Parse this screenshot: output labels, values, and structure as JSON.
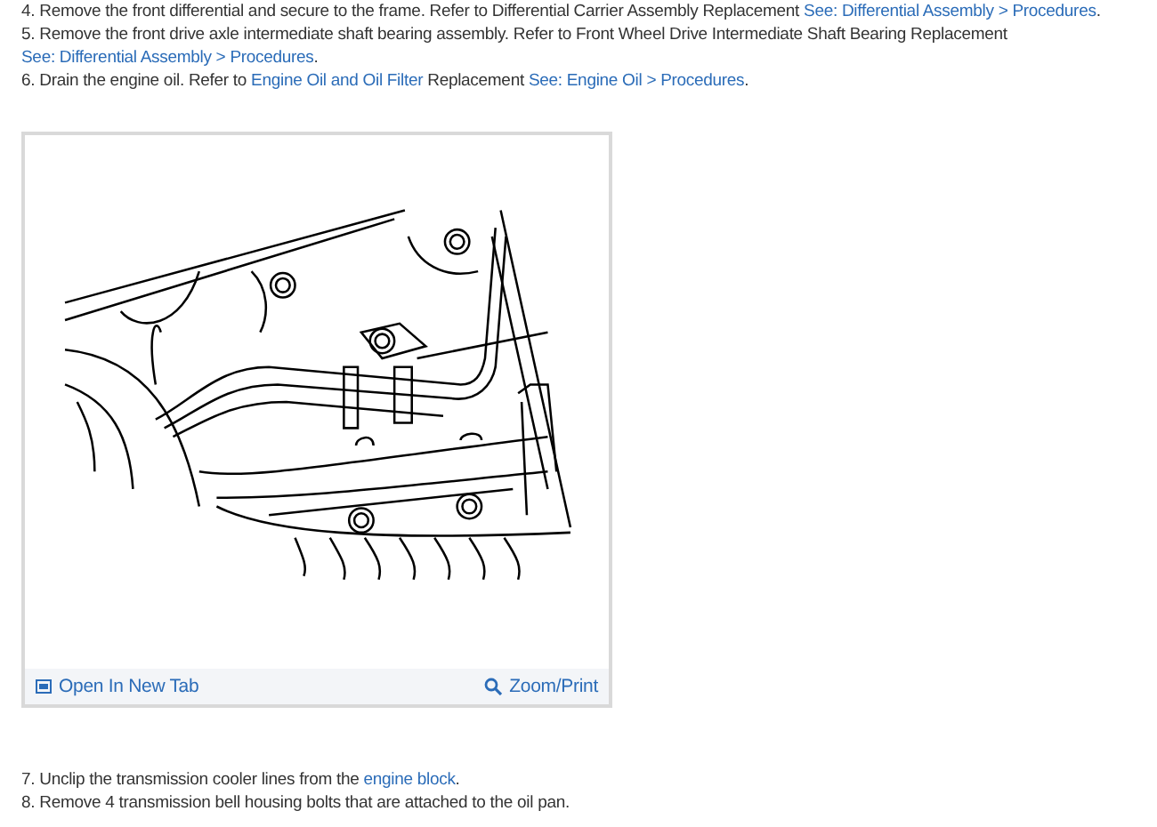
{
  "steps_before": [
    {
      "number": "4.",
      "parts": [
        {
          "kind": "text",
          "text": "Remove the front differential and secure to the frame. Refer to Differential Carrier Assembly Replacement "
        },
        {
          "kind": "link",
          "text": "See: Differential Assembly > Procedures"
        },
        {
          "kind": "text",
          "text": "."
        }
      ]
    },
    {
      "number": "5.",
      "parts": [
        {
          "kind": "text",
          "text": "Remove the front drive axle intermediate shaft bearing assembly. Refer to Front Wheel Drive Intermediate Shaft Bearing Replacement "
        },
        {
          "kind": "link",
          "text": "See: Differential Assembly > Procedures"
        },
        {
          "kind": "text",
          "text": "."
        }
      ]
    },
    {
      "number": "6.",
      "parts": [
        {
          "kind": "text",
          "text": "Drain the engine oil. Refer to "
        },
        {
          "kind": "link",
          "text": "Engine Oil and Oil Filter"
        },
        {
          "kind": "text",
          "text": " Replacement "
        },
        {
          "kind": "link",
          "text": "See: Engine Oil > Procedures"
        },
        {
          "kind": "text",
          "text": "."
        }
      ]
    }
  ],
  "figure": {
    "open_link": "Open In New Tab",
    "zoom_link": "Zoom/Print"
  },
  "steps_after": [
    {
      "number": "7.",
      "parts": [
        {
          "kind": "text",
          "text": "Unclip the transmission cooler lines from the "
        },
        {
          "kind": "link",
          "text": "engine block"
        },
        {
          "kind": "text",
          "text": "."
        }
      ]
    },
    {
      "number": "8.",
      "parts": [
        {
          "kind": "text",
          "text": "Remove 4 transmission bell housing bolts that are attached to the oil pan."
        }
      ]
    }
  ]
}
